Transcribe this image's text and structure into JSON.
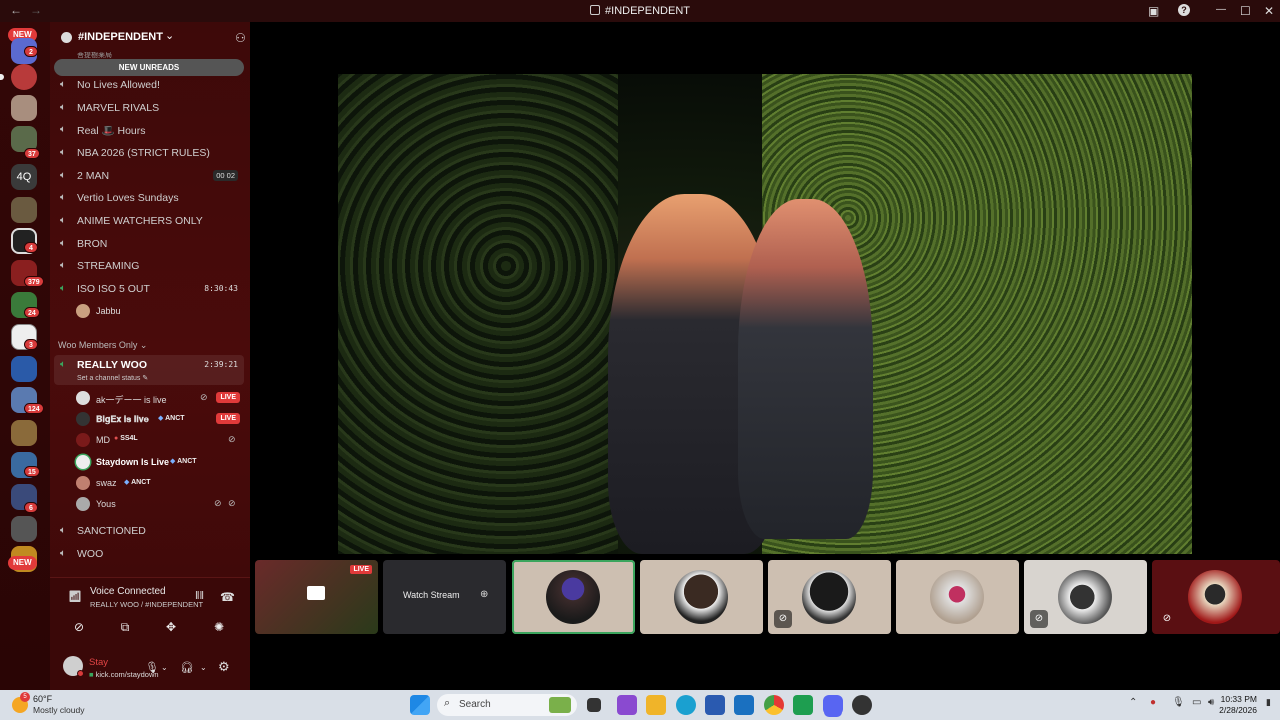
{
  "window": {
    "title": "#INDEPENDENT",
    "nav_back": "←",
    "nav_fwd": "→",
    "help": "?",
    "minimize": "—",
    "maximize": "☐",
    "close": "✕"
  },
  "rail": {
    "new_top": "NEW",
    "new_bottom": "NEW",
    "home_badge": "2",
    "server_4q": "4Q",
    "counts": [
      "37",
      "4",
      "379",
      "24",
      "3",
      "124",
      "15",
      "6"
    ]
  },
  "server": {
    "name": "#INDEPENDENT",
    "chevron": "⌄"
  },
  "new_unreads": "NEW UNREADS",
  "partial_channel": "菩提樹薬局",
  "channels": [
    {
      "label": "No Lives Allowed!"
    },
    {
      "label": "MARVEL RIVALS"
    },
    {
      "label": "Real 🎩 Hours"
    },
    {
      "label": "NBA 2026 (STRICT RULES)"
    },
    {
      "label": "2 MAN",
      "count_a": "00",
      "count_b": "02"
    },
    {
      "label": "Vertio Loves Sundays"
    },
    {
      "label": "ANIME WATCHERS ONLY"
    },
    {
      "label": "BRON"
    },
    {
      "label": "STREAMING"
    },
    {
      "label": "ISO ISO 5 OUT",
      "time": "8:30:43"
    }
  ],
  "iso_member": "Jabbu",
  "category": "Woo Members Only ⌄",
  "active_channel": {
    "label": "REALLY WOO",
    "time": "2:39:21",
    "status": "Set a channel status ✎"
  },
  "members": [
    {
      "name": "ak一デー一 is live",
      "live": "LIVE"
    },
    {
      "name": "𝐁𝐢𝐠𝐄𝐱 𝐢𝐬 𝐥𝐢𝐯𝐞",
      "tag": "ANCT",
      "live": "LIVE"
    },
    {
      "name": "MD",
      "tag": "SS4L"
    },
    {
      "name": "Staydown Is Live",
      "tag": "ANCT"
    },
    {
      "name": "swaz",
      "tag": "ANCT"
    },
    {
      "name": "Yous"
    }
  ],
  "channels_after": [
    {
      "label": "SANCTIONED"
    },
    {
      "label": "WOO"
    }
  ],
  "voice": {
    "status": "Voice Connected",
    "location": "REALLY WOO / #INDEPENDENT",
    "user_name": "Stay",
    "user_status": "kick.com/staydown"
  },
  "stage": {
    "tile_live": "LIVE",
    "watch_stream": "Watch Stream"
  },
  "taskbar": {
    "temp": "60°F",
    "weather": "Mostly cloudy",
    "weather_badge": "5",
    "search": "Search",
    "time": "10:33 PM",
    "date": "2/28/2026"
  },
  "colors": {
    "accent": "#e23a3a",
    "sidebar": "#3d0909",
    "rail": "#330707",
    "speaking": "#3ba55d"
  }
}
